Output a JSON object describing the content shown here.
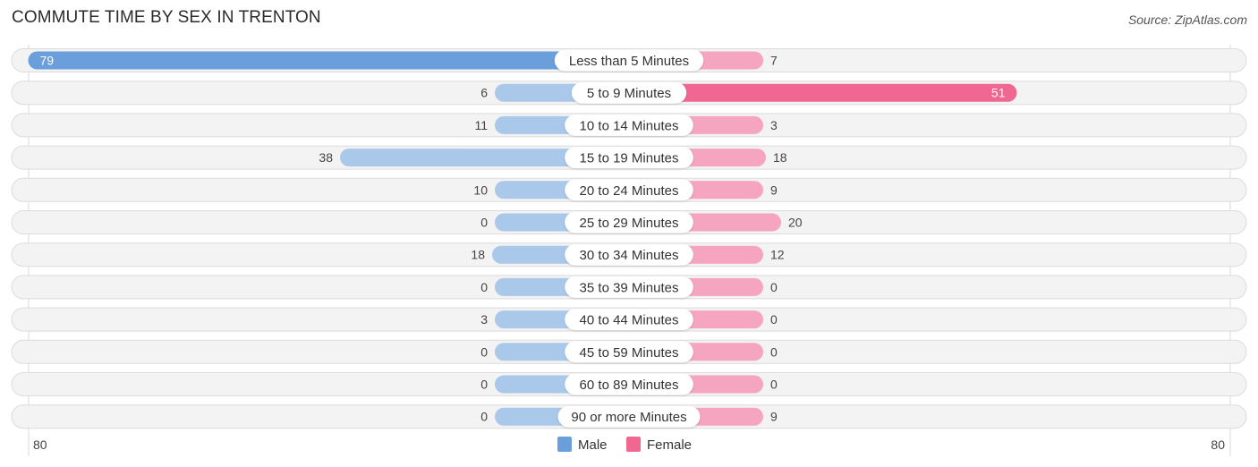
{
  "header": {
    "title": "COMMUTE TIME BY SEX IN TRENTON",
    "source": "Source: ZipAtlas.com"
  },
  "chart_data": {
    "type": "bar",
    "orientation": "horizontal-diverging",
    "title": "COMMUTE TIME BY SEX IN TRENTON",
    "categories": [
      "Less than 5 Minutes",
      "5 to 9 Minutes",
      "10 to 14 Minutes",
      "15 to 19 Minutes",
      "20 to 24 Minutes",
      "25 to 29 Minutes",
      "30 to 34 Minutes",
      "35 to 39 Minutes",
      "40 to 44 Minutes",
      "45 to 59 Minutes",
      "60 to 89 Minutes",
      "90 or more Minutes"
    ],
    "series": [
      {
        "name": "Male",
        "color": "#6a9fdc",
        "color_light": "#a9c8ea",
        "values": [
          79,
          6,
          11,
          38,
          10,
          0,
          18,
          0,
          3,
          0,
          0,
          0
        ]
      },
      {
        "name": "Female",
        "color": "#f06791",
        "color_light": "#f5a5bf",
        "values": [
          7,
          51,
          3,
          18,
          9,
          20,
          12,
          0,
          0,
          0,
          0,
          9
        ]
      }
    ],
    "axis": {
      "left_max": 80,
      "right_max": 80,
      "left_label": "80",
      "right_label": "80"
    },
    "legend": {
      "position": "bottom-center",
      "entries": [
        "Male",
        "Female"
      ]
    },
    "grid": false
  }
}
